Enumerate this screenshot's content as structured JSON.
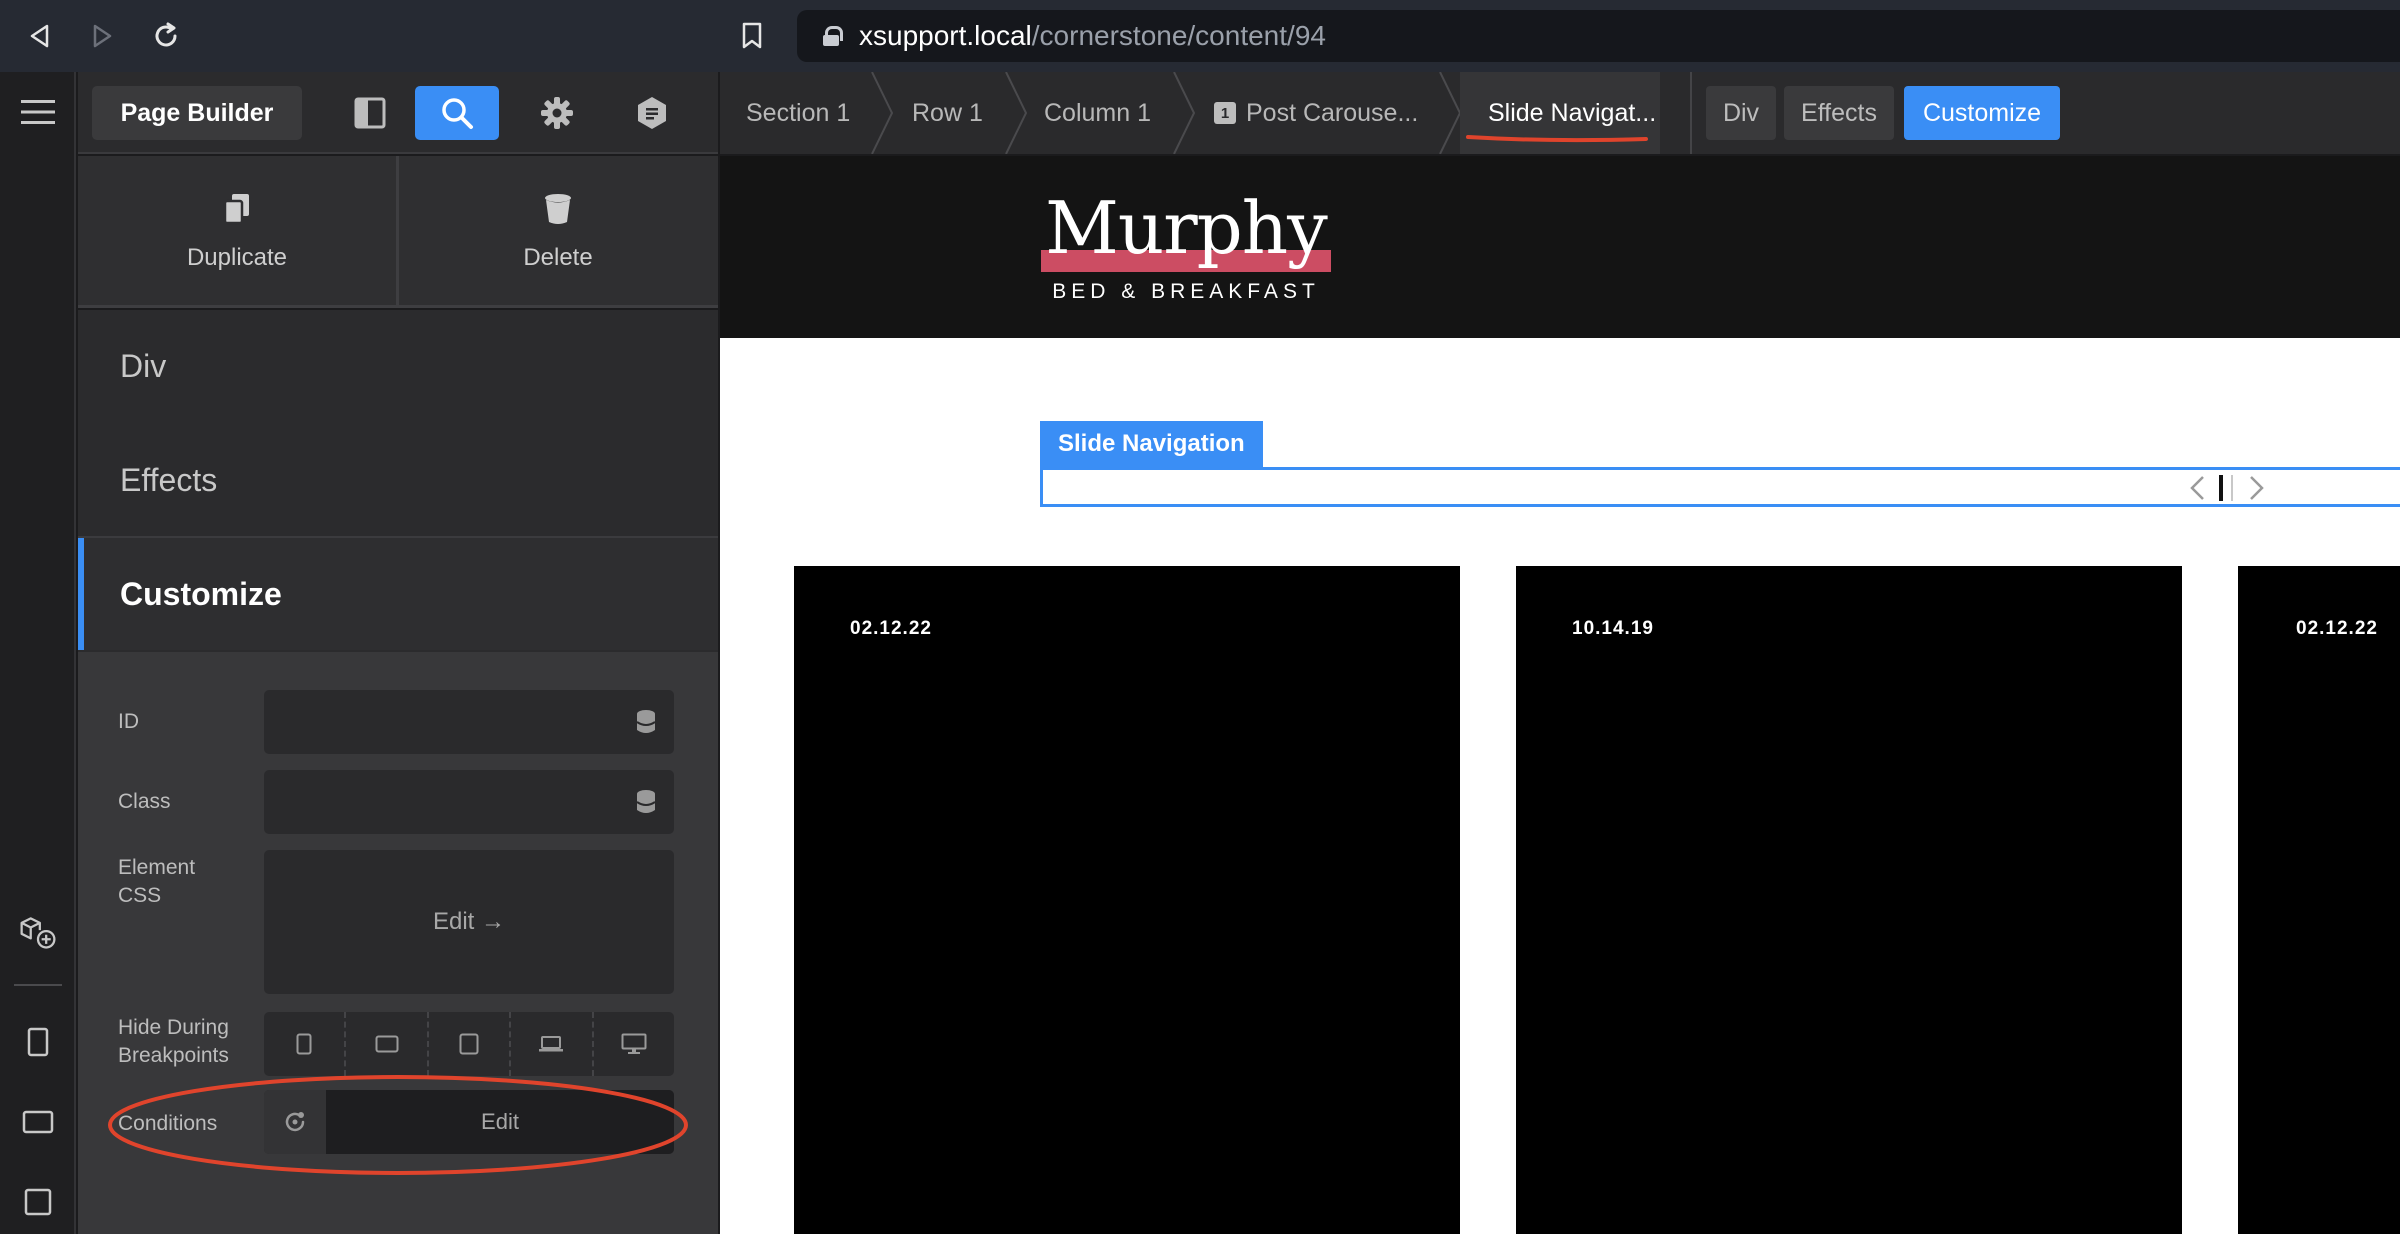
{
  "browser": {
    "url_host": "xsupport.local",
    "url_path": "/cornerstone/content/94"
  },
  "toolbar": {
    "title": "Page Builder"
  },
  "actions": {
    "duplicate": "Duplicate",
    "delete": "Delete"
  },
  "tabs": [
    {
      "label": "Div"
    },
    {
      "label": "Effects"
    },
    {
      "label": "Customize",
      "active": true
    }
  ],
  "controls": {
    "id_label": "ID",
    "id_value": "",
    "class_label": "Class",
    "class_value": "",
    "element_css_label": "Element CSS",
    "element_css_button": "Edit →",
    "hide_label": "Hide During Breakpoints",
    "conditions_label": "Conditions",
    "conditions_button": "Edit"
  },
  "breadcrumbs": [
    {
      "label": "Section 1"
    },
    {
      "label": "Row 1"
    },
    {
      "label": "Column 1"
    },
    {
      "badge": "1",
      "label": "Post Carouse..."
    },
    {
      "label": "Slide Navigat...",
      "active": true
    }
  ],
  "mode_tabs": [
    {
      "label": "Div"
    },
    {
      "label": "Effects"
    },
    {
      "label": "Customize",
      "active": true
    }
  ],
  "site": {
    "logo_name": "Murphy",
    "logo_tagline": "BED & BREAKFAST",
    "slide_nav_label": "Slide Navigation",
    "cards": [
      {
        "date": "02.12.22"
      },
      {
        "date": "10.14.19"
      },
      {
        "date": "02.12.22"
      }
    ]
  },
  "colors": {
    "accent": "#3a8ef5",
    "logo_accent": "#cc4d63",
    "annotation": "#e0442c"
  }
}
